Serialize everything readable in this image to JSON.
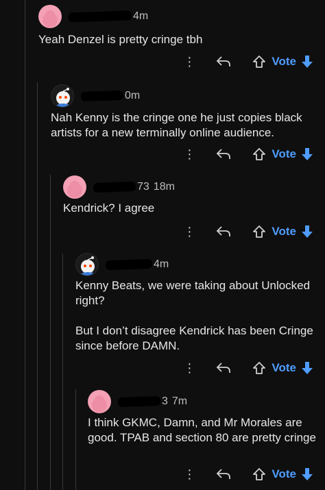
{
  "comments": [
    {
      "name_tail": "4m",
      "time": "",
      "avatar": "pink-snoo-avatar",
      "body": "Yeah Denzel is pretty cringe tbh"
    },
    {
      "name_tail": "0m",
      "time": "",
      "avatar": "white-snoo-avatar",
      "body": "Nah Kenny is the cringe one he just copies black artists for a new terminally online audience."
    },
    {
      "name_tail": "73",
      "time": "18m",
      "avatar": "pink-snoo-avatar",
      "body": "Kendrick? I agree"
    },
    {
      "name_tail": "4m",
      "time": "",
      "avatar": "white-snoo-avatar",
      "body": "Kenny Beats, we were taking about Unlocked right?\n\nBut I don’t disagree Kendrick has been Cringe since before DAMN."
    },
    {
      "name_tail": "3",
      "time": "7m",
      "avatar": "pink-snoo-avatar",
      "body": "I think GKMC, Damn, and Mr Morales are good. TPAB and section 80 are pretty cringe"
    }
  ],
  "actions": {
    "more": "⋮",
    "vote_label": "Vote"
  },
  "colors": {
    "background": "#0f0f0f",
    "vote_blue": "#4f9dff",
    "avatar_pink": "#f4a1b5"
  }
}
